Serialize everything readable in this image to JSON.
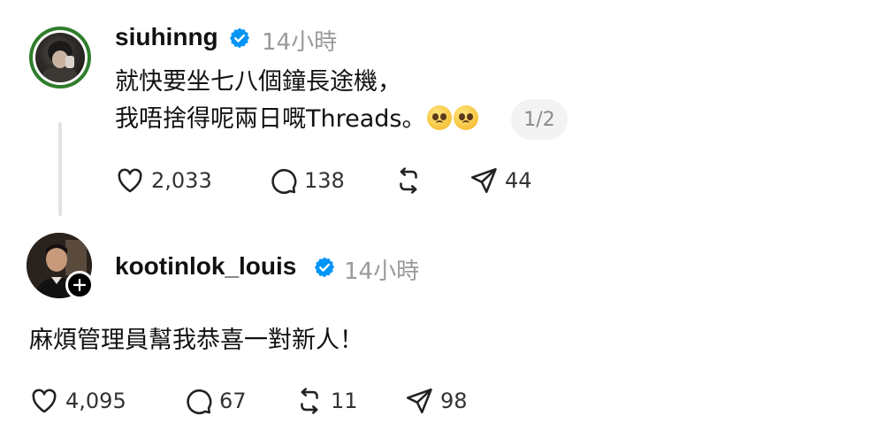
{
  "posts": [
    {
      "username": "siuhinng",
      "timestamp": "14小時",
      "text_line1": "就快要坐七八個鐘長途機，",
      "text_line2": "我唔捨得呢兩日嘅Threads。",
      "emoji_name": "pleading-face-emoji",
      "page_indicator": "1/2",
      "likes": "2,033",
      "replies": "138",
      "shares": "44"
    },
    {
      "username": "kootinlok_louis",
      "timestamp": "14小時",
      "text": "麻煩管理員幫我恭喜一對新人！",
      "likes": "4,095",
      "replies": "67",
      "reposts": "11",
      "shares": "98"
    }
  ],
  "icons": {
    "like": "heart-icon",
    "reply": "comment-icon",
    "repost": "repost-icon",
    "share": "send-icon",
    "verified": "verified-badge-icon",
    "follow": "plus-icon"
  },
  "colors": {
    "verified_blue": "#0095f6",
    "avatar_ring": "#2f7d2c",
    "muted_text": "#9a9a9a"
  }
}
